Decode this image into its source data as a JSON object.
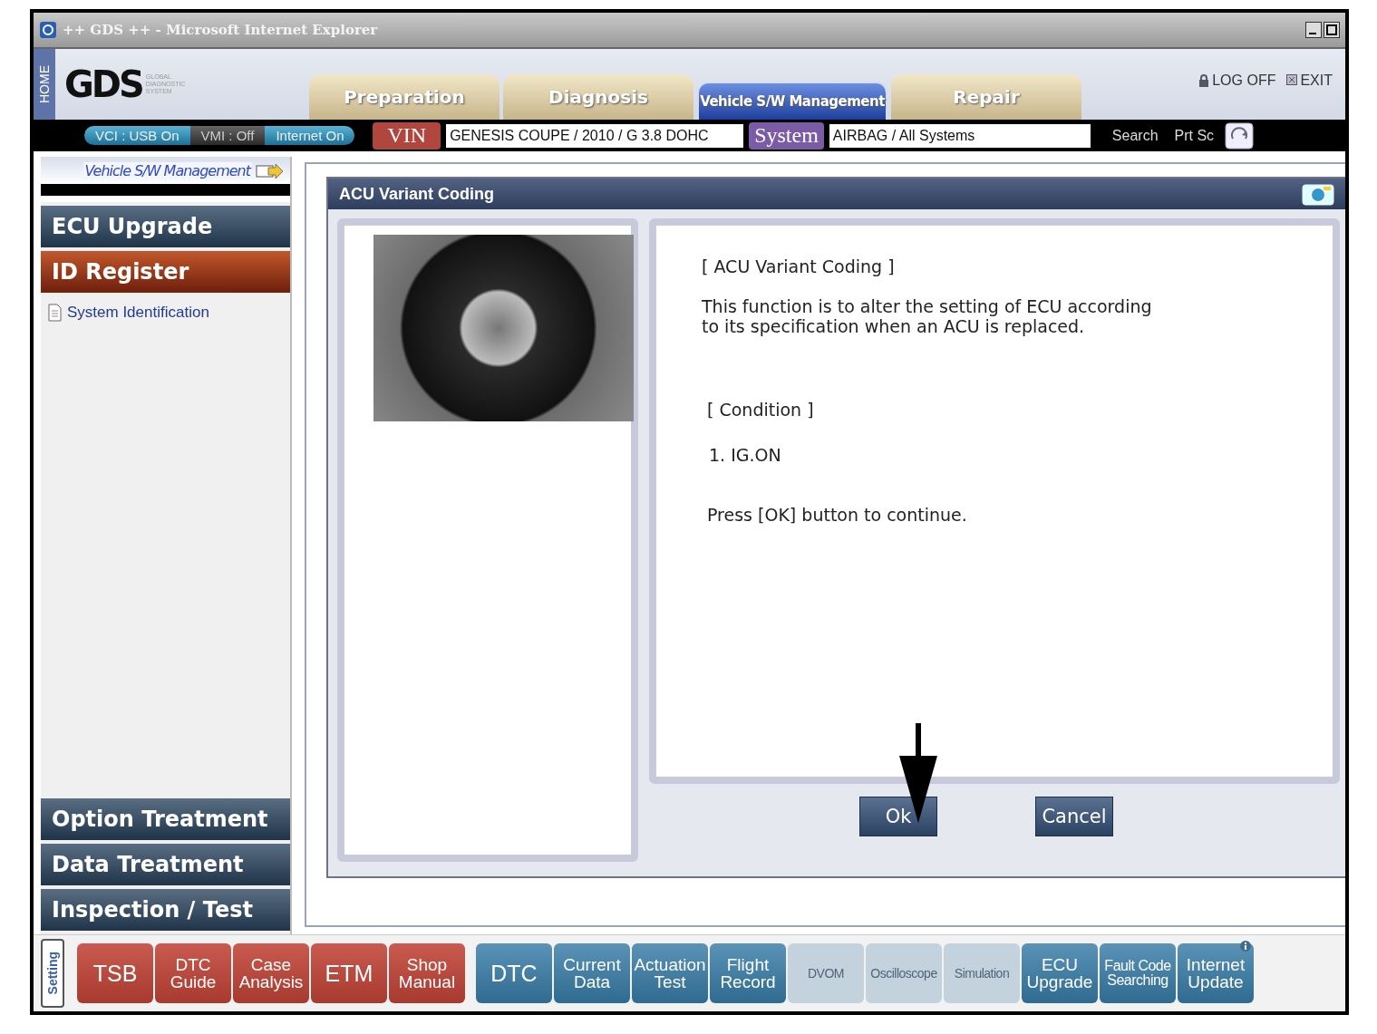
{
  "window": {
    "title": "++ GDS ++ - Microsoft Internet Explorer"
  },
  "header": {
    "home_tab": "HOME",
    "logo": "GDS",
    "logo_subtitle": "GLOBAL DIAGNOSTIC SYSTEM",
    "tabs": [
      {
        "label": "Preparation",
        "selected": false
      },
      {
        "label": "Diagnosis",
        "selected": false
      },
      {
        "label": "Vehicle S/W Management",
        "selected": true
      },
      {
        "label": "Repair",
        "selected": false
      }
    ],
    "links": [
      "LOG OFF",
      "EXIT"
    ]
  },
  "status_bar": {
    "indicators": [
      {
        "label": "VCI : USB On",
        "on": true
      },
      {
        "label": "VMI : Off",
        "on": false
      },
      {
        "label": "Internet On",
        "on": true
      }
    ],
    "vin_label": "VIN",
    "vin_value": "GENESIS COUPE / 2010 / G 3.8 DOHC",
    "system_label": "System",
    "system_value": "AIRBAG / All Systems",
    "tools": [
      "Search",
      "Prt Sc"
    ]
  },
  "sidebar": {
    "title": "Vehicle S/W Management",
    "items": [
      {
        "label": "ECU Upgrade",
        "selected": false
      },
      {
        "label": "ID Register",
        "selected": true,
        "children": [
          {
            "label": "System Identification"
          }
        ]
      },
      {
        "label": "Option Treatment",
        "selected": false
      },
      {
        "label": "Data Treatment",
        "selected": false
      },
      {
        "label": "Inspection / Test",
        "selected": false
      }
    ]
  },
  "dialog": {
    "title": "ACU Variant Coding",
    "heading": "[ ACU Variant Coding ]",
    "description": "This function is to alter the setting of ECU according\n to its specification when an ACU is replaced.",
    "condition_heading": "[ Condition ]",
    "conditions": [
      "1. IG.ON"
    ],
    "instruction": "Press [OK] button to continue.",
    "buttons": [
      "Ok",
      "Cancel"
    ]
  },
  "toolbar": {
    "setting_tab": "Setting",
    "buttons": [
      {
        "label": "TSB",
        "kind": "info",
        "disabled": false
      },
      {
        "label": "DTC\nGuide",
        "kind": "info",
        "disabled": false
      },
      {
        "label": "Case\nAnalysis",
        "kind": "info",
        "disabled": false
      },
      {
        "label": "ETM",
        "kind": "info",
        "disabled": false
      },
      {
        "label": "Shop\nManual",
        "kind": "info",
        "disabled": false
      },
      {
        "label": "DTC",
        "kind": "diag",
        "disabled": false
      },
      {
        "label": "Current\nData",
        "kind": "diag",
        "disabled": false
      },
      {
        "label": "Actuation\nTest",
        "kind": "diag",
        "disabled": false
      },
      {
        "label": "Flight\nRecord",
        "kind": "diag",
        "disabled": false
      },
      {
        "label": "DVOM",
        "kind": "diag",
        "disabled": true
      },
      {
        "label": "Oscilloscope",
        "kind": "diag",
        "disabled": true
      },
      {
        "label": "Simulation",
        "kind": "diag",
        "disabled": true
      },
      {
        "label": "ECU\nUpgrade",
        "kind": "diag",
        "disabled": false
      },
      {
        "label": "Fault Code\nSearching",
        "kind": "diag",
        "disabled": false
      },
      {
        "label": "Internet\nUpdate",
        "kind": "diag",
        "disabled": false
      }
    ]
  }
}
